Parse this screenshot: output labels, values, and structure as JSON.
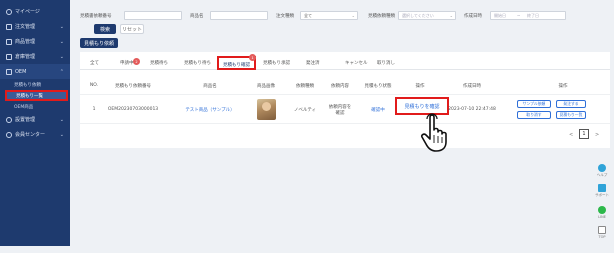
{
  "sidebar": {
    "items": [
      {
        "label": "マイページ",
        "icon": "home-icon"
      },
      {
        "label": "注文管理",
        "icon": "order-icon"
      },
      {
        "label": "商品管理",
        "icon": "product-icon"
      },
      {
        "label": "倉庫管理",
        "icon": "warehouse-icon"
      },
      {
        "label": "OEM",
        "icon": "oem-icon"
      },
      {
        "label": "設置管理",
        "icon": "settings-icon"
      },
      {
        "label": "会員センター",
        "icon": "member-icon"
      }
    ],
    "oem_sub": [
      "見積もり依頼",
      "見積もり一覧",
      "OEM商品"
    ]
  },
  "search": {
    "quote_no_label": "見積書依頼番号",
    "product_name_label": "商品名",
    "status_label": "注文種類",
    "status_value": "全て",
    "shop_label": "見積依頼種類",
    "shop_placeholder": "選択してください",
    "date_label": "作成日時",
    "date_start": "開始日",
    "date_end": "終了日",
    "search_btn": "検索",
    "reset_btn": "リセット",
    "create_btn": "見積もり依頼"
  },
  "tabs": [
    {
      "label": "全て"
    },
    {
      "label": "申請中",
      "badge": "2"
    },
    {
      "label": "見積待ち"
    },
    {
      "label": "見積もり待ち"
    },
    {
      "label": "見積もり確認",
      "badge": "1"
    },
    {
      "label": "見積もり承認"
    },
    {
      "label": "発注済"
    },
    {
      "label": "キャンセル"
    },
    {
      "label": "取り消し"
    }
  ],
  "columns": [
    "NO.",
    "見積もり依頼番号",
    "商品名",
    "商品画像",
    "依頼種類",
    "依頼内容",
    "見積もり状態",
    "操作",
    "作成日時",
    "操作"
  ],
  "rows": [
    {
      "no": "1",
      "quote_no": "OEM20230703000013",
      "product": "テスト商品（サンプル）",
      "type": "ノベルティ",
      "content": "依頼内容を確認",
      "state": "確認中",
      "action": "見積もりを確認",
      "created": "2023-07-10 22:47:48",
      "ops": [
        "サンプル依頼",
        "発注する",
        "取り消す",
        "見積もり一覧"
      ]
    }
  ],
  "pager": {
    "prev": "<",
    "page": "1",
    "next": ">"
  },
  "floatbar": [
    {
      "label": "ヘルプ",
      "color": "#2fa3d8"
    },
    {
      "label": "サポート",
      "color": "#2fa3d8"
    },
    {
      "label": "LINE",
      "color": "#2cb84a"
    },
    {
      "label": "TOP",
      "color": "#8a8a8a"
    }
  ]
}
